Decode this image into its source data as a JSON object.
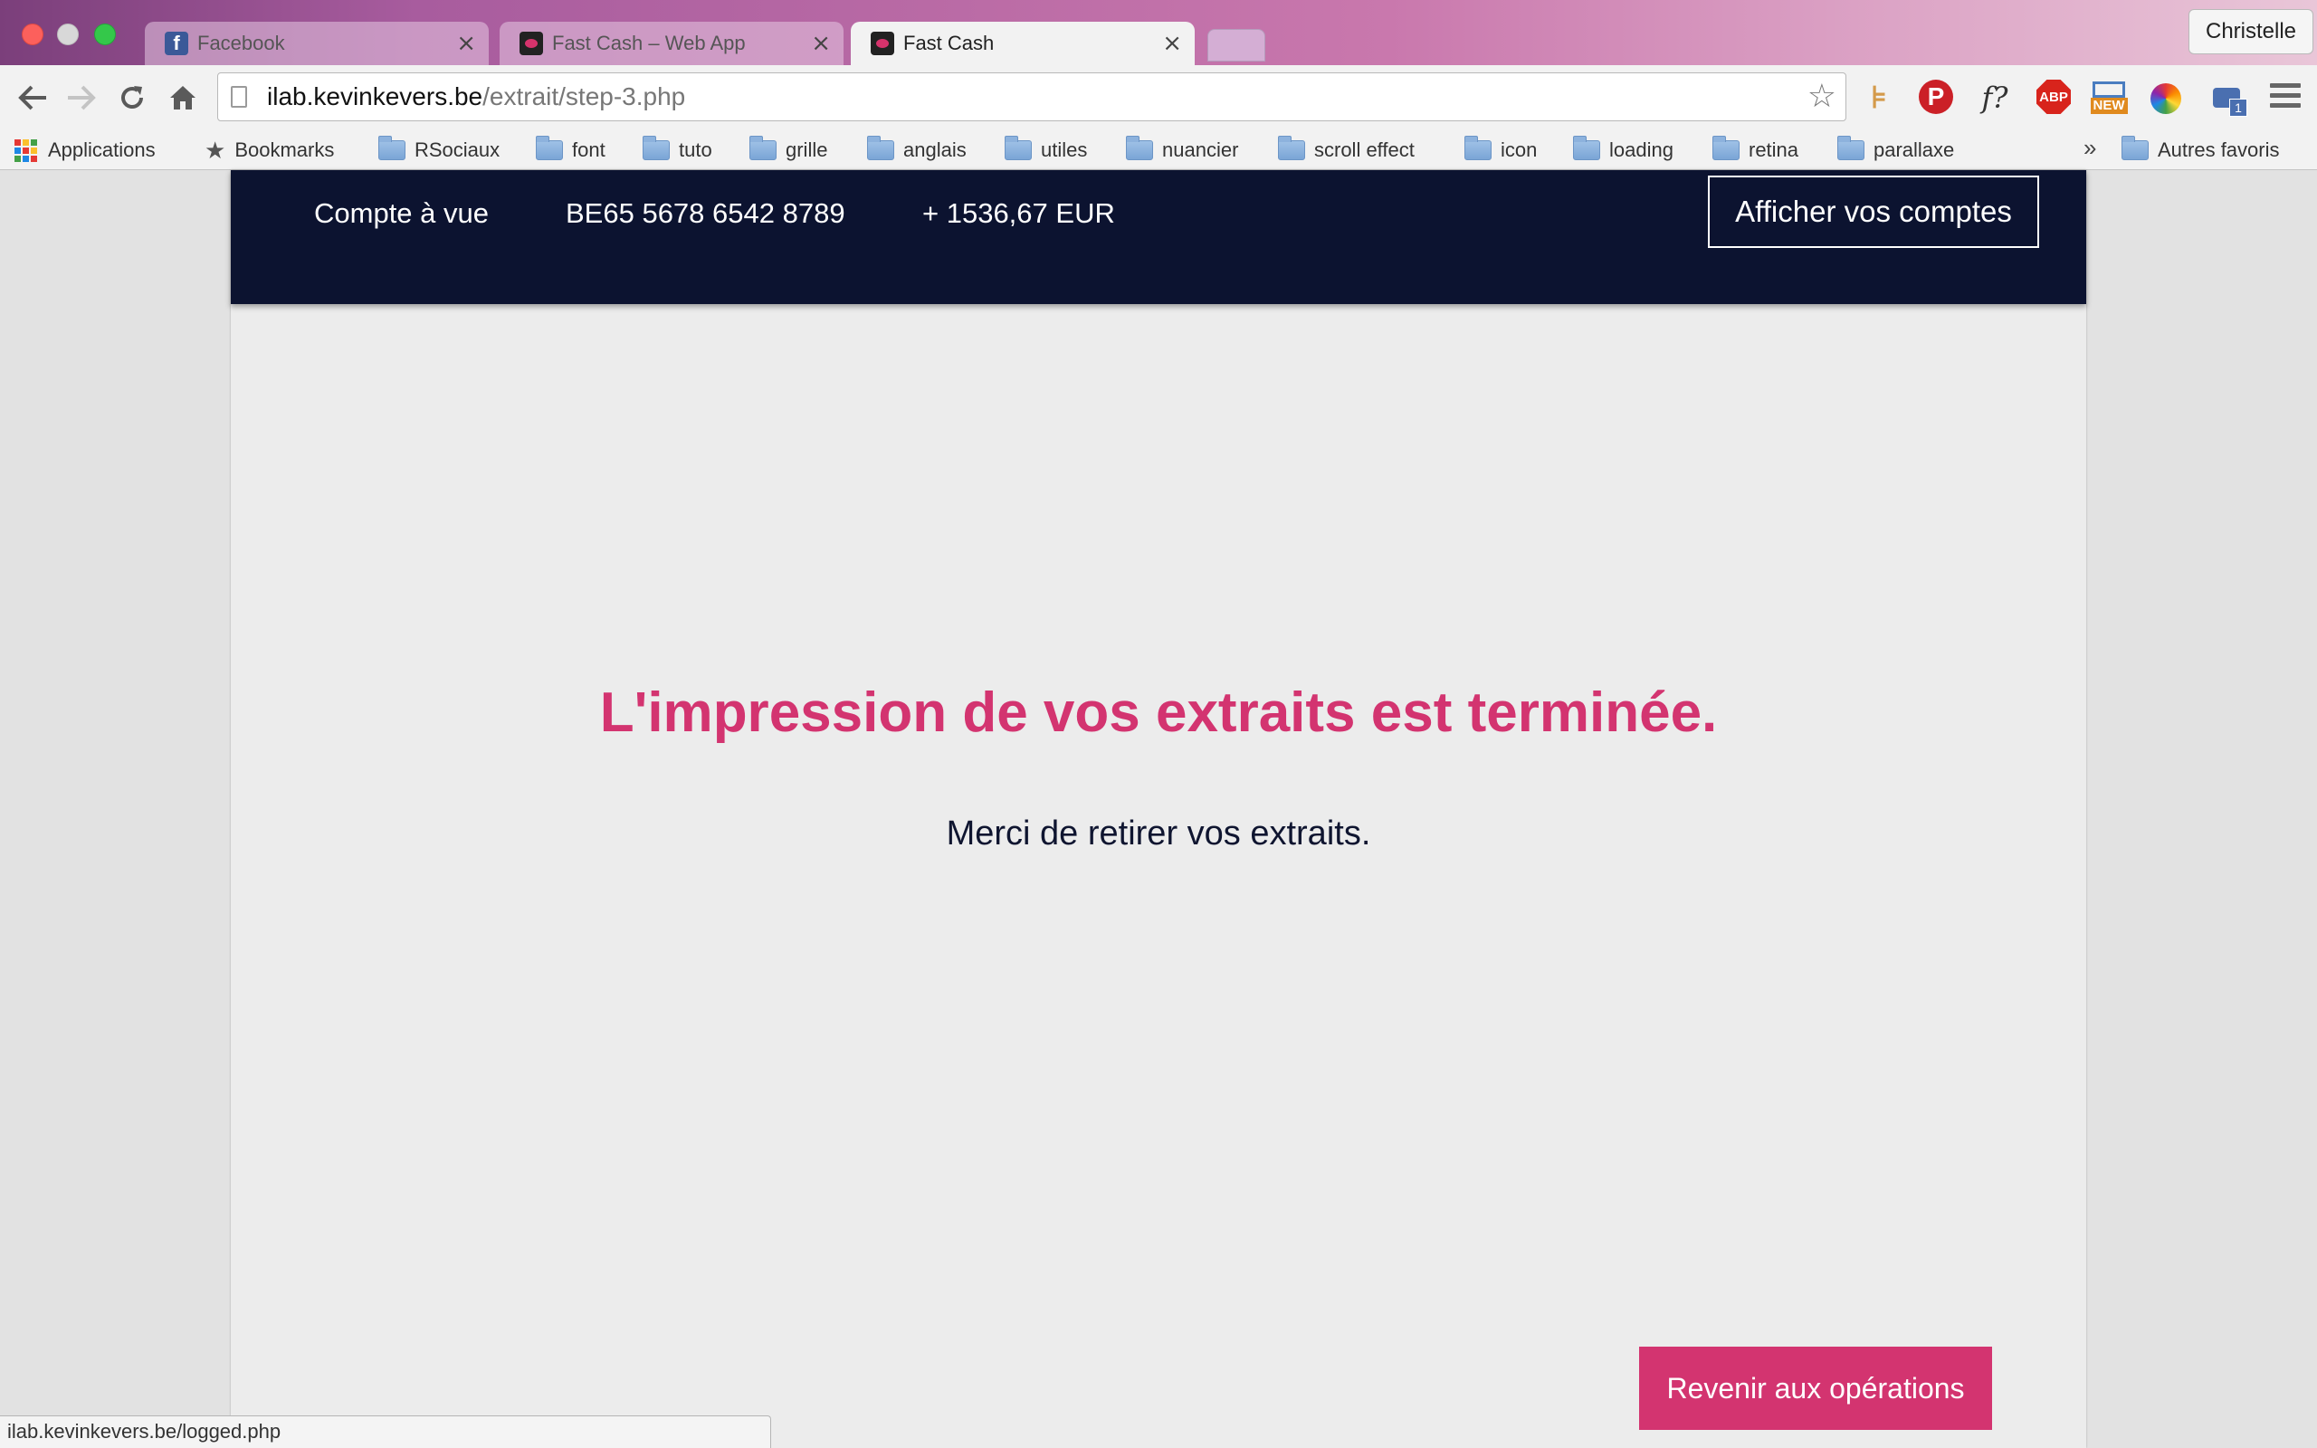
{
  "browser": {
    "tabs": [
      {
        "label": "Facebook",
        "favicon": "facebook-icon"
      },
      {
        "label": "Fast Cash – Web App",
        "favicon": "fastcash-icon"
      },
      {
        "label": "Fast Cash",
        "favicon": "fastcash-icon",
        "active": true
      }
    ],
    "tab_close_glyph": "×",
    "profile_name": "Christelle",
    "url_host": "ilab.kevinkevers.be",
    "url_path": "/extrait/step-3.php",
    "status_url": "ilab.kevinkevers.be/logged.php"
  },
  "bookmarks": {
    "apps_label": "Applications",
    "bookmarks_label": "Bookmarks",
    "folders": [
      "RSociaux",
      "font",
      "tuto",
      "grille",
      "anglais",
      "utiles",
      "nuancier",
      "scroll effect",
      "icon",
      "loading",
      "retina",
      "parallaxe"
    ],
    "more_glyph": "»",
    "other_label": "Autres favoris"
  },
  "extensions": {
    "abp_label": "ABP",
    "new_badge": "NEW",
    "f_label": "f?",
    "pinterest_label": "P",
    "badge_count": "1"
  },
  "account": {
    "type": "Compte à vue",
    "iban": "BE65 5678 6542 8789",
    "balance": "+ 1536,67 EUR",
    "button_label": "Afficher vos comptes"
  },
  "main": {
    "title": "L'impression de vos extraits est terminée.",
    "subtitle": "Merci de retirer vos extraits.",
    "back_button": "Revenir aux opérations"
  },
  "colors": {
    "accent": "#d33470",
    "header_bg": "#0c1330",
    "page_bg": "#ececec"
  }
}
